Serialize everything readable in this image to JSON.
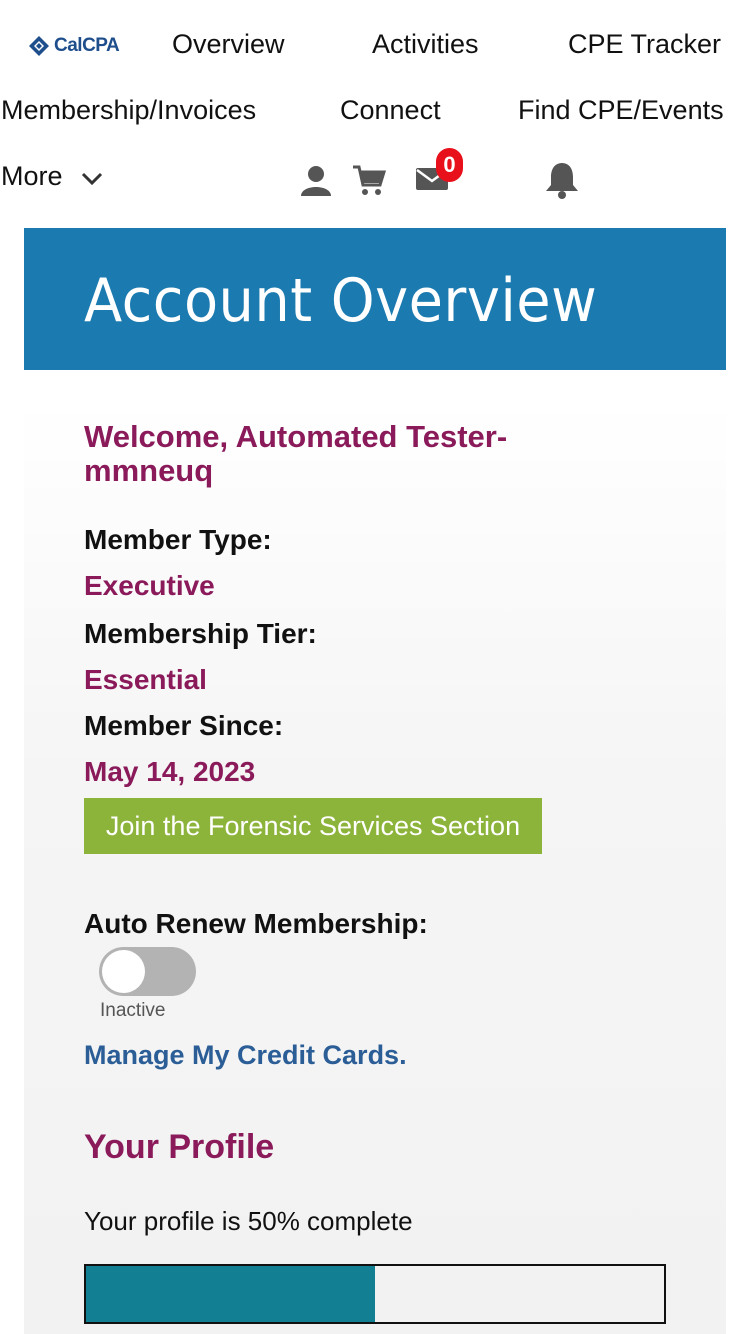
{
  "nav": {
    "logo_text": "CalCPA",
    "links": {
      "overview": "Overview",
      "activities": "Activities",
      "cpe_tracker": "CPE Tracker",
      "membership": "Membership/Invoices",
      "connect": "Connect",
      "find_cpe": "Find CPE/Events",
      "more": "More"
    },
    "icons": [
      "user-icon",
      "cart-icon",
      "mail-icon",
      "bell-icon",
      "chevron-down-icon"
    ],
    "mail_badge": "0"
  },
  "hero": {
    "title": "Account Overview",
    "background": "#1b7bb0"
  },
  "account": {
    "welcome": "Welcome, Automated Tester-mmneuq",
    "member_type_label": "Member Type:",
    "member_type": "Executive",
    "tier_label": "Membership Tier:",
    "tier": "Essential",
    "since_label": "Member Since:",
    "since": "May 14, 2023",
    "join_button": "Join the Forensic Services Section",
    "auto_renew_label": "Auto Renew Membership:",
    "auto_renew_on": false,
    "auto_renew_state": "Inactive",
    "credit_cards_link": "Manage My Credit Cards."
  },
  "profile": {
    "title": "Your Profile",
    "completion_text": "Your profile is 50% complete",
    "completion_percent": 50
  },
  "colors": {
    "accent_purple": "#8a1a5a",
    "button_green": "#8cb33a",
    "link_blue": "#2b5d96",
    "progress_teal": "#137f93",
    "badge_red": "#e8101b"
  }
}
